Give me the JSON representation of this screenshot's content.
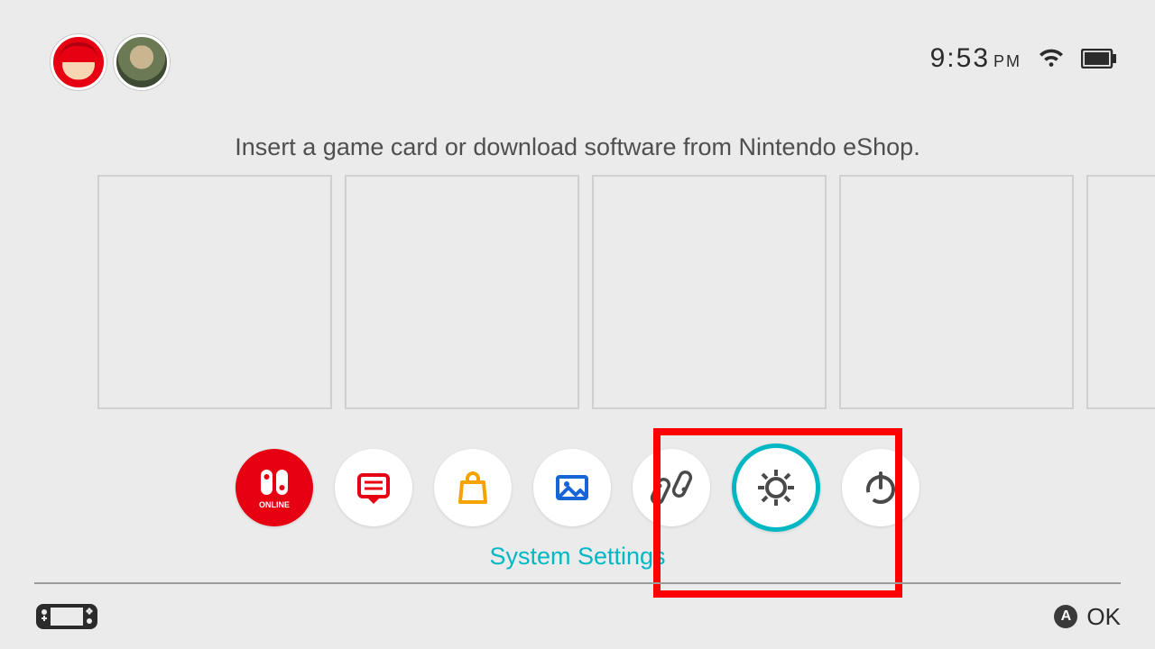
{
  "status": {
    "time_hm": "9:53",
    "time_ampm": "PM",
    "wifi_name": "wifi-icon",
    "battery_name": "battery-icon"
  },
  "users": [
    {
      "id": "mario",
      "name": "Mario avatar"
    },
    {
      "id": "link",
      "name": "Link avatar"
    }
  ],
  "hint_text": "Insert a game card or download software from Nintendo eShop.",
  "dock": {
    "online_label": "ONLINE",
    "items": [
      {
        "id": "online",
        "name": "Nintendo Switch Online"
      },
      {
        "id": "news",
        "name": "News"
      },
      {
        "id": "eshop",
        "name": "Nintendo eShop"
      },
      {
        "id": "album",
        "name": "Album"
      },
      {
        "id": "controllers",
        "name": "Controllers"
      },
      {
        "id": "settings",
        "name": "System Settings",
        "selected": true
      },
      {
        "id": "sleep",
        "name": "Sleep Mode"
      }
    ],
    "selected_label": "System Settings"
  },
  "footer": {
    "button_a_letter": "A",
    "ok_label": "OK"
  },
  "colors": {
    "accent": "#00b8c4",
    "nintendo_red": "#e60012",
    "highlight_box": "#fe0000"
  }
}
